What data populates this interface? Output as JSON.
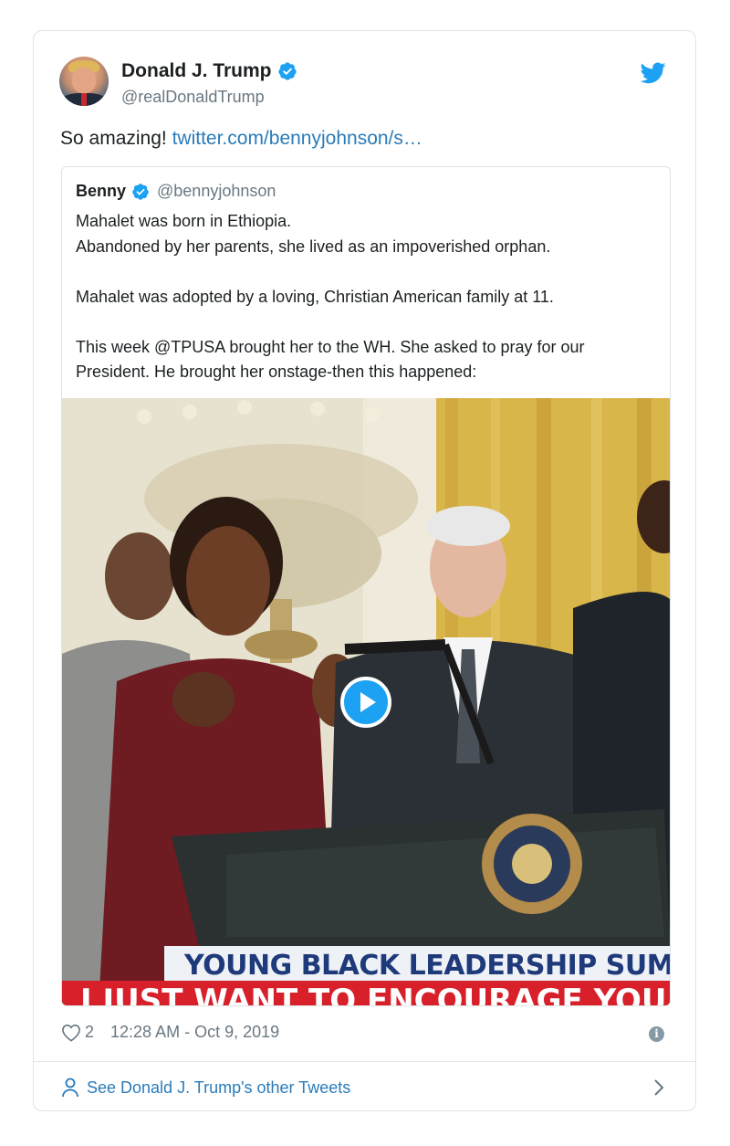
{
  "author": {
    "display_name": "Donald J. Trump",
    "handle": "@realDonaldTrump"
  },
  "tweet": {
    "text": "So amazing! ",
    "link": "twitter.com/bennyjohnson/s…"
  },
  "quoted": {
    "display_name": "Benny",
    "handle": "@bennyjohnson",
    "lines": [
      "Mahalet was born in Ethiopia.",
      "Abandoned by her parents, she lived as an impoverished orphan.",
      "Mahalet was adopted by a loving, Christian American family at 11.",
      "This week @TPUSA brought her to the WH. She asked to pray for our President. He brought her onstage-then this happened:"
    ],
    "video": {
      "banner_text": "YOUNG BLACK LEADERSHIP SUMMIT",
      "caption_text": "I JUST WANT TO ENCOURAGE YOU"
    }
  },
  "meta": {
    "like_count": "2",
    "timestamp": "12:28 AM - Oct 9, 2019"
  },
  "footer": {
    "link_label": "See Donald J. Trump's other Tweets"
  },
  "colors": {
    "brand": "#1da1f2",
    "link": "#2b7bb9",
    "secondary_text": "#697882"
  },
  "icons": [
    "twitter-bird-icon",
    "verified-badge-icon",
    "play-icon",
    "heart-icon",
    "info-icon",
    "person-icon",
    "chevron-right-icon"
  ]
}
